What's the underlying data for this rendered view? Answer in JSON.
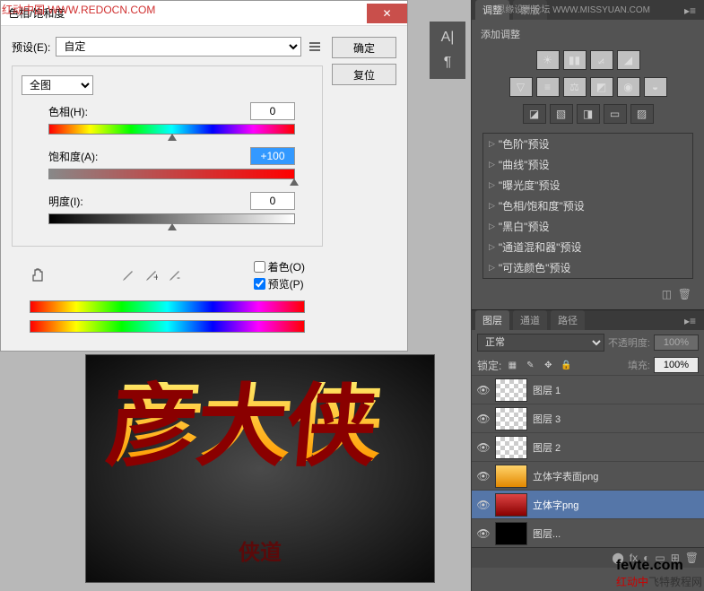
{
  "watermarks": {
    "top": "红动中国 WWW.REDOCN.COM",
    "top_right": "思缘设计论坛 WWW.MISSYUAN.COM",
    "bottom_brand": "fevte.com",
    "bottom_cn": "飞特教程网",
    "bottom_red": "红动中"
  },
  "dialog": {
    "title": "色相/饱和度",
    "preset_label": "预设(E):",
    "preset_value": "自定",
    "channel_value": "全图",
    "hue_label": "色相(H):",
    "hue_value": "0",
    "sat_label": "饱和度(A):",
    "sat_value": "+100",
    "light_label": "明度(I):",
    "light_value": "0",
    "colorize_label": "着色(O)",
    "preview_label": "预览(P)",
    "ok": "确定",
    "reset": "复位"
  },
  "canvas": {
    "main_text": "彦大侠",
    "sub_text": "侠道"
  },
  "adjustments": {
    "tab1": "调整",
    "tab2": "蒙版",
    "add_label": "添加调整",
    "presets": [
      "\"色阶\"预设",
      "\"曲线\"预设",
      "\"曝光度\"预设",
      "\"色相/饱和度\"预设",
      "\"黑白\"预设",
      "\"通道混和器\"预设",
      "\"可选颜色\"预设"
    ]
  },
  "layers": {
    "tab1": "图层",
    "tab2": "通道",
    "tab3": "路径",
    "blend_mode": "正常",
    "opacity_label": "不透明度:",
    "opacity_value": "100%",
    "lock_label": "锁定:",
    "fill_label": "填充:",
    "fill_value": "100%",
    "items": [
      {
        "name": "图层 1",
        "thumb": "checker"
      },
      {
        "name": "图层 3",
        "thumb": "checker"
      },
      {
        "name": "图层 2",
        "thumb": "checker"
      },
      {
        "name": "立体字表面png",
        "thumb": "gold"
      },
      {
        "name": "立体字png",
        "thumb": "red",
        "selected": true
      },
      {
        "name": "图层...",
        "thumb": "black"
      }
    ]
  }
}
